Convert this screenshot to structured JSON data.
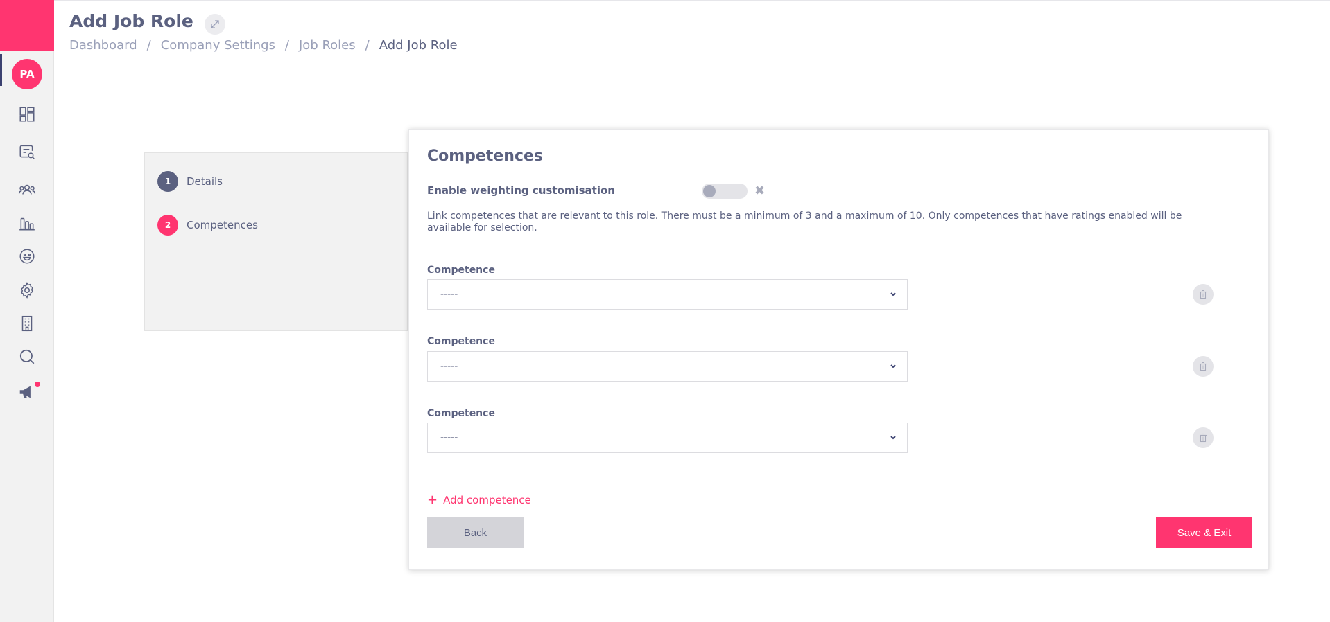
{
  "user": {
    "initials": "PA"
  },
  "header": {
    "title": "Add Job Role",
    "breadcrumb": [
      "Dashboard",
      "Company Settings",
      "Job Roles",
      "Add Job Role"
    ]
  },
  "sidebar": {
    "icons": [
      "dashboard-icon",
      "search-document-icon",
      "people-icon",
      "bar-chart-icon",
      "smiley-icon",
      "gear-icon",
      "building-icon",
      "search-icon",
      "megaphone-icon"
    ]
  },
  "steps": [
    {
      "number": "1",
      "label": "Details"
    },
    {
      "number": "2",
      "label": "Competences"
    }
  ],
  "form": {
    "title": "Competences",
    "toggle_label": "Enable weighting customisation",
    "toggle_enabled": false,
    "description": "Link competences that are relevant to this role. There must be a minimum of 3 and a maximum of 10. Only competences that have ratings enabled will be available for selection.",
    "competences": [
      {
        "label": "Competence",
        "value": "-----"
      },
      {
        "label": "Competence",
        "value": "-----"
      },
      {
        "label": "Competence",
        "value": "-----"
      }
    ],
    "add_label": "Add competence",
    "back_label": "Back",
    "save_label": "Save & Exit"
  },
  "colors": {
    "accent": "#ff3570",
    "text": "#5b6180",
    "muted": "#9aa0b8",
    "step_done": "#5b6180"
  }
}
